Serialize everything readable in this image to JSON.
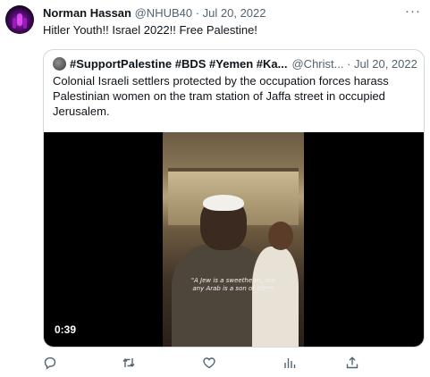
{
  "tweet": {
    "author_name": "Norman Hassan",
    "meta": "@NHUB40 · Jul 20, 2022",
    "more_label": "···",
    "text": "Hitler Youth!! Israel 2022!! Free Palestine!"
  },
  "quote": {
    "author_name": "#SupportPalestine #BDS #Yemen #Ka...",
    "meta": "@Christ... · Jul 20, 2022",
    "text": "Colonial Israeli settlers protected by the occupation forces harass Palestinian women on the tram station of Jaffa street in occupied Jerusalem.",
    "video": {
      "caption_line1": "\"A Jew is a sweetheart, but",
      "caption_line2": "any Arab is a son of bit***",
      "duration": "0:39"
    }
  },
  "actions": [
    {
      "name": "reply",
      "icon": "reply-icon"
    },
    {
      "name": "retweet",
      "icon": "retweet-icon"
    },
    {
      "name": "like",
      "icon": "heart-icon"
    },
    {
      "name": "views",
      "icon": "views-chart-icon"
    },
    {
      "name": "share",
      "icon": "share-icon"
    }
  ],
  "colors": {
    "text": "#0f1419",
    "secondary": "#536471",
    "border": "#cfd9de"
  }
}
